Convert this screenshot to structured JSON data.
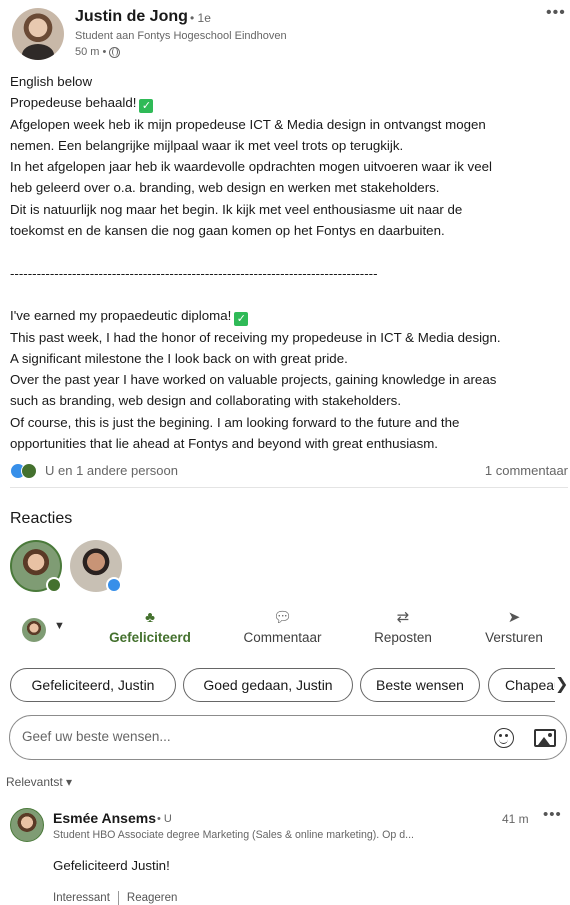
{
  "author": {
    "name": "Justin de Jong",
    "degree": "• 1e",
    "headline": "Student aan Fontys Hogeschool Eindhoven",
    "time": "50 m •"
  },
  "post_lines": [
    "English below",
    "Propedeuse behaald!",
    "Afgelopen week heb ik mijn propedeuse ICT & Media design in ontvangst mogen",
    "nemen. Een belangrijke mijlpaal waar ik met veel trots op terugkijk.",
    "In het afgelopen jaar heb ik waardevolle opdrachten mogen uitvoeren waar ik veel",
    "heb geleerd over o.a. branding, web design en werken met stakeholders.",
    "Dit is natuurlijk nog maar het begin. Ik kijk met veel enthousiasme uit naar de",
    "toekomst en de kansen die nog gaan komen op het Fontys en daarbuiten.",
    "",
    "-----------------------------------------------------------------------------------",
    "",
    "I've earned my propaedeutic diploma!",
    "This past week, I had the honor of receiving my propedeuse in ICT & Media design.",
    "A significant milestone the I look back on with great pride.",
    "Over the past year I have worked on valuable projects, gaining knowledge in areas",
    "such as branding, web design and collaborating with stakeholders.",
    "Of course, this is just the begining. I am looking forward to the future and the",
    "opportunities that lie ahead at Fontys and beyond with great enthusiasm."
  ],
  "checkmark": "✓",
  "reactions_summary": "U en 1 andere persoon",
  "comment_count": "1 commentaar",
  "reactions_title": "Reacties",
  "actions": {
    "celebrate": "Gefeliciteerd",
    "comment": "Commentaar",
    "repost": "Reposten",
    "send": "Versturen"
  },
  "chips": [
    "Gefeliciteerd, Justin",
    "Goed gedaan, Justin",
    "Beste wensen",
    "Chapeau"
  ],
  "comment_input": {
    "placeholder": "Geef uw beste wensen..."
  },
  "sort_label": "Relevantst",
  "comment": {
    "name": "Esmée Ansems",
    "degree": "• U",
    "time": "41 m",
    "headline": "Student HBO Associate degree Marketing (Sales & online marketing). Op d...",
    "text": "Gefeliciteerd Justin!",
    "action_interesting": "Interessant",
    "action_reply": "Reageren"
  },
  "colors": {
    "celebrate_green": "#44712e",
    "like_blue": "#378fe9",
    "check_green": "#2fba57"
  }
}
